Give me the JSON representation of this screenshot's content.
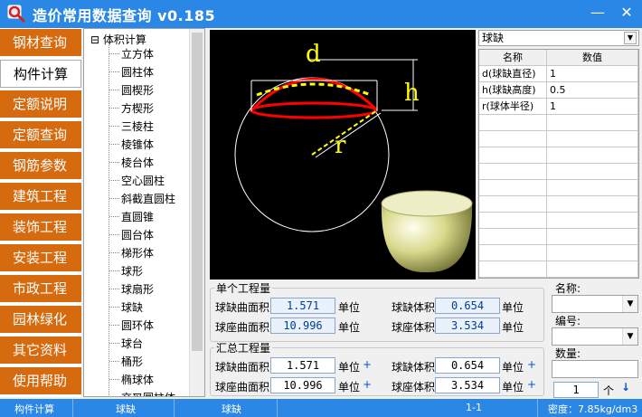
{
  "app": {
    "title": "造价常用数据查询 v0.185"
  },
  "sidebar": {
    "items": [
      {
        "label": "钢材查询"
      },
      {
        "label": "构件计算"
      },
      {
        "label": "定额说明"
      },
      {
        "label": "定额查询"
      },
      {
        "label": "钢筋参数"
      },
      {
        "label": "建筑工程"
      },
      {
        "label": "装饰工程"
      },
      {
        "label": "安装工程"
      },
      {
        "label": "市政工程"
      },
      {
        "label": "园林绿化"
      },
      {
        "label": "其它资料"
      },
      {
        "label": "使用帮助"
      }
    ],
    "active_index": 1
  },
  "tree": {
    "root": "体积计算",
    "nodes": [
      "立方体",
      "圆柱体",
      "圆楔形",
      "方楔形",
      "三棱柱",
      "棱锥体",
      "棱台体",
      "空心圆柱",
      "斜截直圆柱",
      "直圆锥",
      "圆台体",
      "梯形体",
      "球形",
      "球扇形",
      "球缺",
      "圆环体",
      "球台",
      "桶形",
      "椭球体",
      "交叉圆柱体"
    ]
  },
  "diagram": {
    "d_label": "d",
    "h_label": "h",
    "r_label": "r"
  },
  "grid": {
    "selected": "球缺",
    "headers": [
      "名称",
      "数值"
    ],
    "rows": [
      [
        "d(球缺直径)",
        "1"
      ],
      [
        "h(球缺高度)",
        "0.5"
      ],
      [
        "r(球体半径)",
        "1"
      ]
    ]
  },
  "single": {
    "title": "单个工程量",
    "r1_label": "球缺曲面积",
    "r1_value": "1.571",
    "r1_unit": "单位",
    "r1b_label": "球缺体积",
    "r1b_value": "0.654",
    "r1b_unit": "单位",
    "r2_label": "球座曲面积",
    "r2_value": "10.996",
    "r2_unit": "单位",
    "r2b_label": "球座体积",
    "r2b_value": "3.534",
    "r2b_unit": "单位"
  },
  "total": {
    "title": "汇总工程量",
    "r1_label": "球缺曲面积",
    "r1_value": "1.571",
    "r1_unit": "单位",
    "r1b_label": "球缺体积",
    "r1b_value": "0.654",
    "r1b_unit": "单位",
    "r2_label": "球座曲面积",
    "r2_value": "10.996",
    "r2_unit": "单位",
    "r2b_label": "球座体积",
    "r2b_value": "3.534",
    "r2b_unit": "单位",
    "plus": "+"
  },
  "right": {
    "name_label": "名称:",
    "code_label": "编号:",
    "qty_label": "数量:",
    "qty_value": "1",
    "qty_unit": "个",
    "arrow": "↓"
  },
  "status": {
    "s1": "构件计算",
    "s2": "球缺",
    "s3": "球缺",
    "s4": "1-1",
    "s5": "密度：7.85kg/dm3"
  },
  "colors": {
    "title_bar": "#2b87e6",
    "nav": "#d66a0f"
  }
}
